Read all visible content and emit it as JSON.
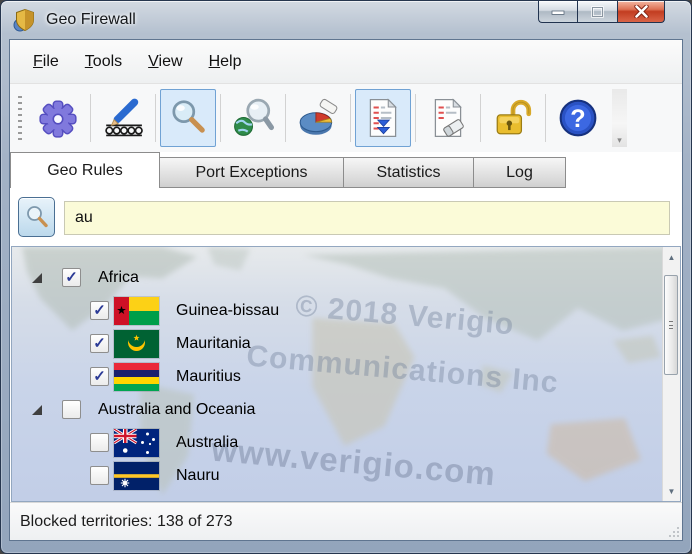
{
  "window": {
    "title": "Geo Firewall"
  },
  "icons": {
    "app": "gold-shield",
    "minimize": "minimize-bar",
    "maximize": "maximize-square",
    "close": "close-x",
    "scroll_up": "▲",
    "scroll_down": "▼",
    "overflow_chevron": "▾"
  },
  "menu": {
    "items": [
      {
        "label": "File"
      },
      {
        "label": "Tools"
      },
      {
        "label": "View"
      },
      {
        "label": "Help"
      }
    ]
  },
  "toolbar": {
    "buttons": [
      {
        "name": "settings",
        "selected": false
      },
      {
        "name": "edit-rules",
        "selected": false
      },
      {
        "name": "search",
        "selected": true
      },
      {
        "name": "geo-lookup",
        "selected": false
      },
      {
        "name": "statistics",
        "selected": false
      },
      {
        "name": "rules-list",
        "selected": true
      },
      {
        "name": "clear-list",
        "selected": false
      },
      {
        "name": "lock",
        "selected": false
      },
      {
        "name": "help",
        "selected": false
      }
    ]
  },
  "tabs": [
    {
      "label": "Geo Rules",
      "active": true
    },
    {
      "label": "Port Exceptions",
      "active": false
    },
    {
      "label": "Statistics",
      "active": false
    },
    {
      "label": "Log",
      "active": false
    }
  ],
  "search": {
    "value": "au"
  },
  "tree": {
    "groups": [
      {
        "label": "Africa",
        "checked": true,
        "check": "✓",
        "expanded": true,
        "children": [
          {
            "label": "Guinea-bissau",
            "checked": true,
            "check": "✓",
            "flag": "guinea-bissau"
          },
          {
            "label": "Mauritania",
            "checked": true,
            "check": "✓",
            "flag": "mauritania"
          },
          {
            "label": "Mauritius",
            "checked": true,
            "check": "✓",
            "flag": "mauritius"
          }
        ]
      },
      {
        "label": "Australia and Oceania",
        "checked": false,
        "check": "",
        "expanded": true,
        "children": [
          {
            "label": "Australia",
            "checked": false,
            "check": "",
            "flag": "australia"
          },
          {
            "label": "Nauru",
            "checked": false,
            "check": "",
            "flag": "nauru"
          }
        ]
      }
    ]
  },
  "watermark": {
    "lines": [
      "© 2018 Verigio",
      "Communications Inc",
      "www.verigio.com"
    ]
  },
  "status": {
    "text": "Blocked territories: 138 of 273"
  },
  "colors": {
    "toolbar_selected_bg": "#d9eafa",
    "toolbar_selected_border": "#70a2d4",
    "search_input_bg": "#fbfbd8",
    "close_button_red": "#c23c20",
    "check_blue": "#2b3a96",
    "map_ocean": "#c9d4e9"
  }
}
